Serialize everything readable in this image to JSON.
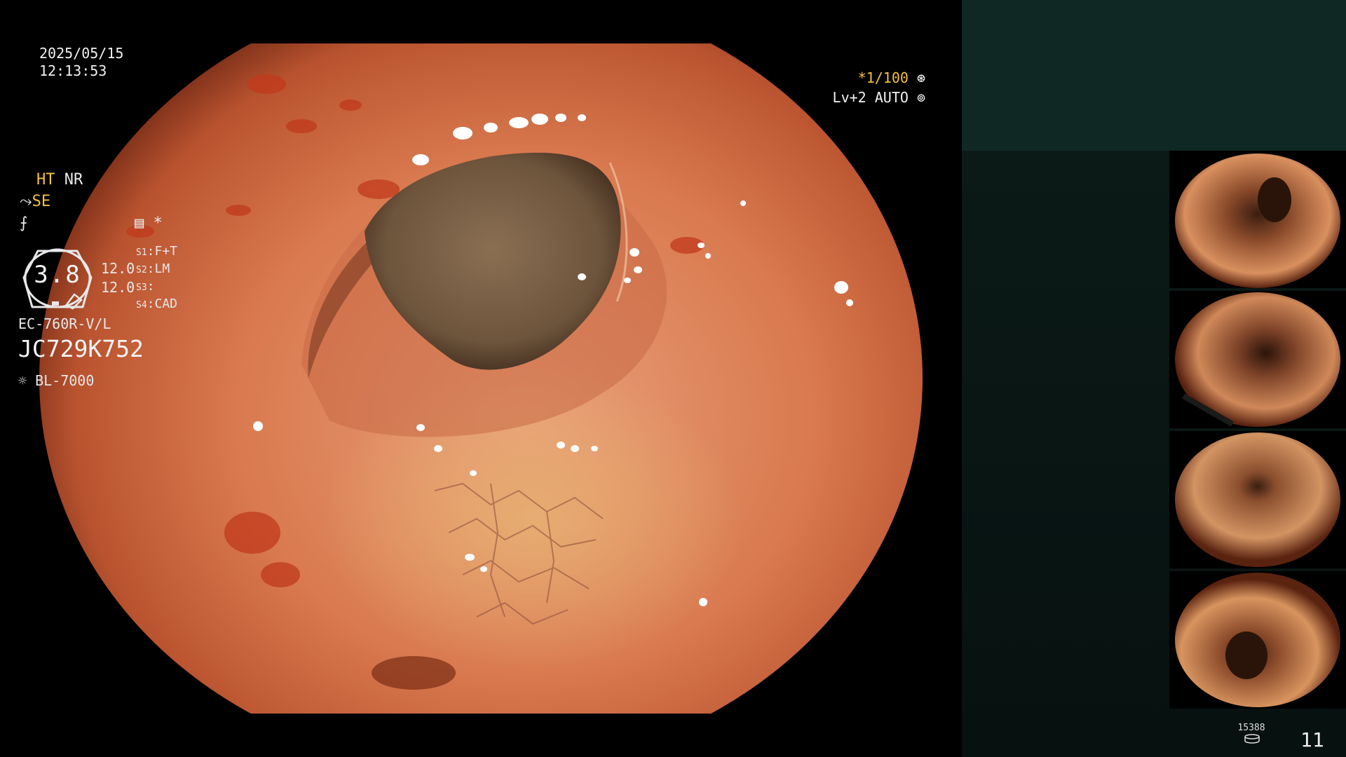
{
  "osd": {
    "date": "2025/05/15",
    "time": "12:13:53",
    "shutter": "*1/100",
    "level": "Lv+2 AUTO"
  },
  "panel": {
    "ht": "HT",
    "nr": "NR",
    "se": "SE",
    "gauge_value": "3.8",
    "value_a": "12.0",
    "value_b": "12.0",
    "switches": [
      {
        "key": "S1",
        "val": "F+T"
      },
      {
        "key": "S2",
        "val": "LM"
      },
      {
        "key": "S3",
        "val": ""
      },
      {
        "key": "S4",
        "val": "CAD"
      }
    ],
    "scope_model": "EC-760R-V/L",
    "scope_serial": "JC729K752",
    "light_source": "BL-7000"
  },
  "footer": {
    "count": "15388",
    "page": "11"
  },
  "colors": {
    "accent_yellow": "#f3c040",
    "panel_header": "#0f2823",
    "panel_body": "#0b1a17"
  },
  "icons": [
    "shutter-icon",
    "auto-iris-icon",
    "scope-angle-icon",
    "freeze-icon",
    "menu-icon",
    "light-source-icon",
    "disk-icon"
  ]
}
